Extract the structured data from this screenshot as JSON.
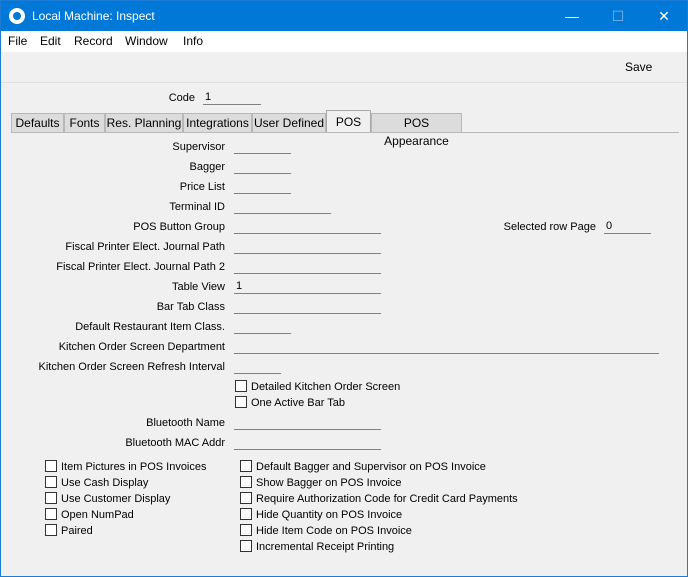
{
  "window": {
    "title": "Local Machine: Inspect",
    "minimize": "—",
    "maximize": "☐",
    "close": "✕"
  },
  "menu": [
    "File",
    "Edit",
    "Record",
    "Window",
    "Info"
  ],
  "toolbar": {
    "save_label": "Save"
  },
  "code": {
    "label": "Code",
    "value": "1"
  },
  "tabs": [
    "Defaults",
    "Fonts",
    "Res. Planning",
    "Integrations",
    "User Defined",
    "POS",
    "POS Appearance"
  ],
  "active_tab": "POS",
  "fields": {
    "supervisor": {
      "label": "Supervisor",
      "value": ""
    },
    "bagger": {
      "label": "Bagger",
      "value": ""
    },
    "price_list": {
      "label": "Price List",
      "value": ""
    },
    "terminal_id": {
      "label": "Terminal ID",
      "value": ""
    },
    "pos_button_group": {
      "label": "POS Button Group",
      "value": ""
    },
    "selected_row_page": {
      "label": "Selected row Page",
      "value": "0"
    },
    "fiscal_path": {
      "label": "Fiscal Printer Elect. Journal Path",
      "value": ""
    },
    "fiscal_path2": {
      "label": "Fiscal Printer Elect. Journal Path 2",
      "value": ""
    },
    "table_view": {
      "label": "Table View",
      "value": "1"
    },
    "bar_tab_class": {
      "label": "Bar Tab Class",
      "value": ""
    },
    "default_restaurant_item_class": {
      "label": "Default Restaurant Item Class.",
      "value": ""
    },
    "kitchen_order_screen_department": {
      "label": "Kitchen Order Screen Department",
      "value": ""
    },
    "kitchen_order_refresh": {
      "label": "Kitchen Order Screen Refresh Interval",
      "value": ""
    },
    "bluetooth_name": {
      "label": "Bluetooth Name",
      "value": ""
    },
    "bluetooth_mac": {
      "label": "Bluetooth MAC Addr",
      "value": ""
    }
  },
  "checkboxes_mid": [
    {
      "label": "Detailed Kitchen Order Screen",
      "checked": false
    },
    {
      "label": "One Active Bar Tab",
      "checked": false
    }
  ],
  "checkboxes_left": [
    {
      "label": "Item Pictures in POS Invoices",
      "checked": false
    },
    {
      "label": "Use Cash Display",
      "checked": false
    },
    {
      "label": "Use Customer Display",
      "checked": false
    },
    {
      "label": "Open NumPad",
      "checked": false
    },
    {
      "label": "Paired",
      "checked": false
    }
  ],
  "checkboxes_right": [
    {
      "label": "Default Bagger and Supervisor on POS Invoice",
      "checked": false
    },
    {
      "label": "Show Bagger on POS Invoice",
      "checked": false
    },
    {
      "label": "Require Authorization Code for Credit Card Payments",
      "checked": false
    },
    {
      "label": "Hide Quantity on POS Invoice",
      "checked": false
    },
    {
      "label": "Hide Item Code on POS Invoice",
      "checked": false
    },
    {
      "label": "Incremental Receipt Printing",
      "checked": false
    }
  ]
}
